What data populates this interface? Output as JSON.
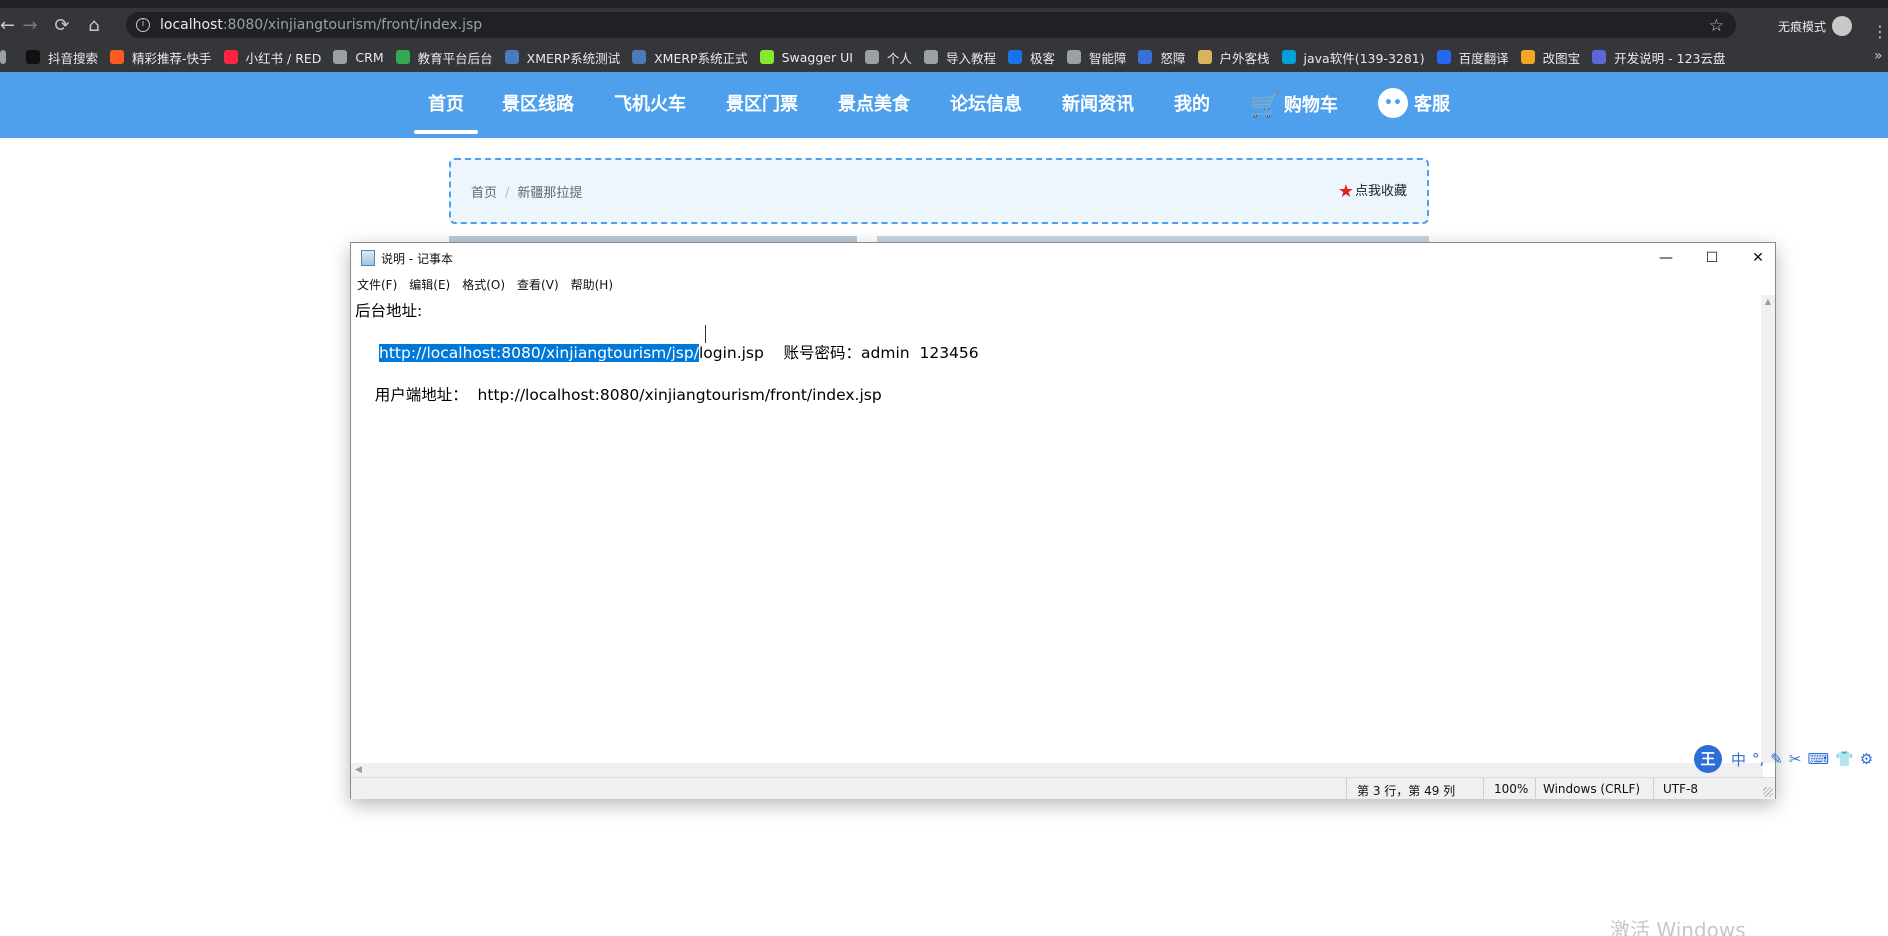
{
  "browser": {
    "url_host": "localhost",
    "url_rest": ":8080/xinjiangtourism/front/index.jsp",
    "incognito_label": "无痕模式",
    "bookmarks": [
      {
        "label": "抖音搜索",
        "color": "#111111"
      },
      {
        "label": "精彩推荐-快手",
        "color": "#ff5a1f"
      },
      {
        "label": "小红书 / RED",
        "color": "#ff2442"
      },
      {
        "label": "CRM",
        "color": "#9aa0a6"
      },
      {
        "label": "教育平台后台",
        "color": "#34a853"
      },
      {
        "label": "XMERP系统测试",
        "color": "#4a7ab8"
      },
      {
        "label": "XMERP系统正式",
        "color": "#4a7ab8"
      },
      {
        "label": "Swagger UI",
        "color": "#85ea2d"
      },
      {
        "label": "个人",
        "color": "#9aa0a6"
      },
      {
        "label": "导入教程",
        "color": "#9aa0a6"
      },
      {
        "label": "极客",
        "color": "#1a73e8"
      },
      {
        "label": "智能障",
        "color": "#9aa0a6"
      },
      {
        "label": "怒障",
        "color": "#3b6fd8"
      },
      {
        "label": "户外客栈",
        "color": "#d9b45a"
      },
      {
        "label": "java软件(139-3281)",
        "color": "#00a1d6"
      },
      {
        "label": "百度翻译",
        "color": "#2468f2"
      },
      {
        "label": "改图宝",
        "color": "#f5a623"
      },
      {
        "label": "开发说明 - 123云盘",
        "color": "#5a67d8"
      }
    ]
  },
  "site": {
    "nav": [
      "首页",
      "景区线路",
      "飞机火车",
      "景区门票",
      "景点美食",
      "论坛信息",
      "新闻资讯",
      "我的",
      "购物车",
      "客服"
    ],
    "breadcrumb": {
      "home": "首页",
      "sep": "/",
      "current": "新疆那拉提"
    },
    "favorite_label": "点我收藏"
  },
  "notepad": {
    "title": "说明 - 记事本",
    "menus": [
      "文件(F)",
      "编辑(E)",
      "格式(O)",
      "查看(V)",
      "帮助(H)"
    ],
    "lines": {
      "line1": "后台地址:",
      "line2_selected": "http://localhost:8080/xinjiangtourism/jsp/",
      "line2_rest": "login.jsp    账号密码：admin  123456",
      "line3": "    用户端地址：  http://localhost:8080/xinjiangtourism/front/index.jsp"
    },
    "status": {
      "position": "第 3 行，第 49 列",
      "zoom": "100%",
      "line_ending": "Windows (CRLF)",
      "encoding": "UTF-8"
    }
  },
  "ime": {
    "logo": "王",
    "mode": "中"
  },
  "watermark": "激活 Windows",
  "colors": {
    "site_nav": "#4ea0ec",
    "selection": "#0078d7",
    "fav_star": "#e52222"
  }
}
